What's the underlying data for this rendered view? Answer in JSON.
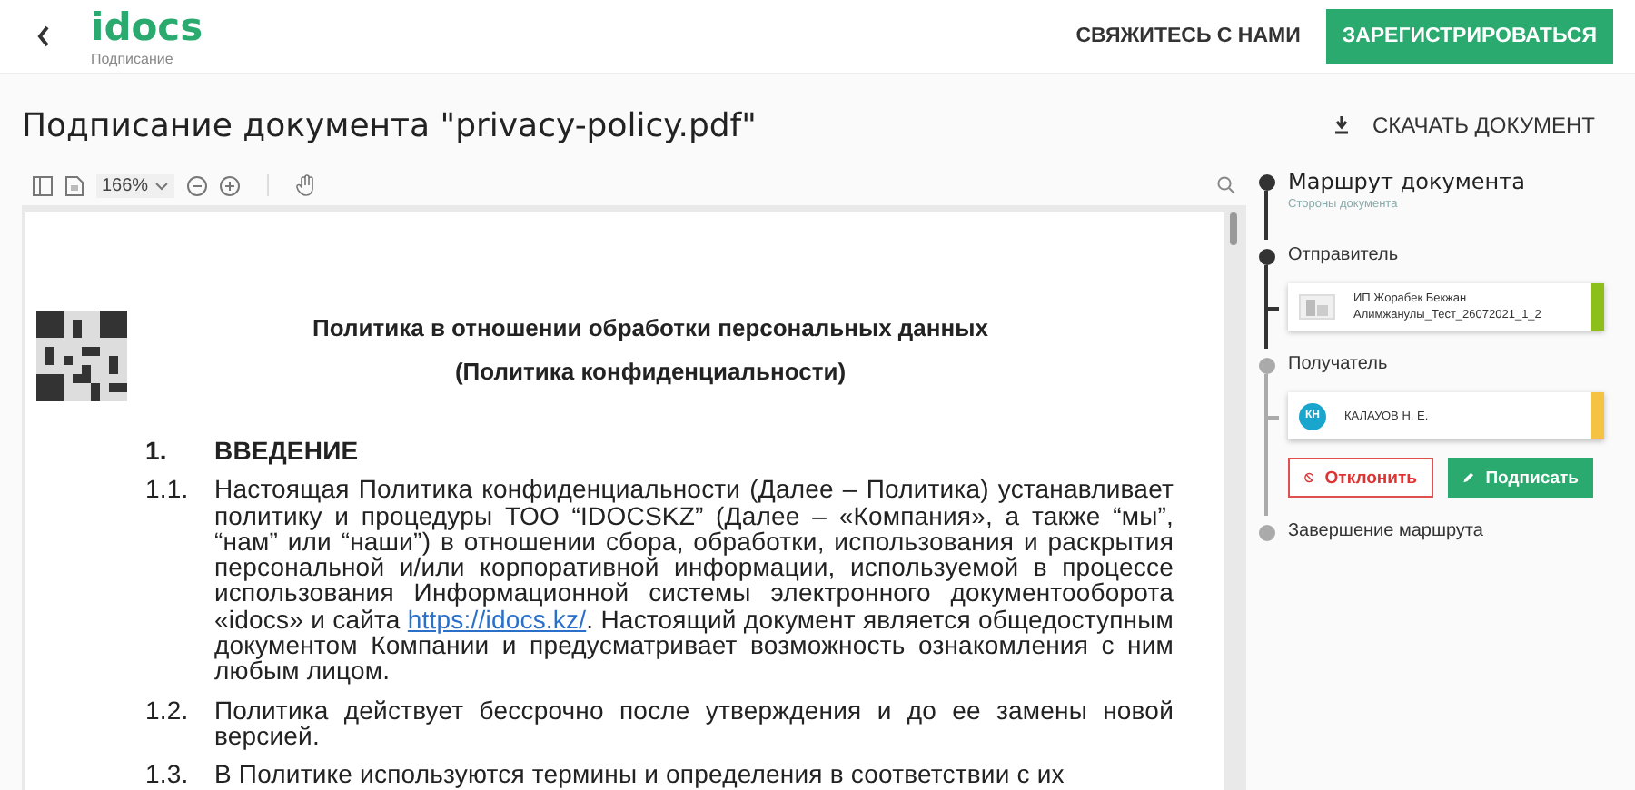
{
  "header": {
    "logo": "idocs",
    "logo_caption": "Подписание",
    "contact": "СВЯЖИТЕСЬ С НАМИ",
    "register": "ЗАРЕГИСТРИРОВАТЬСЯ"
  },
  "page": {
    "title": "Подписание документа \"privacy-policy.pdf\"",
    "download": "СКАЧАТЬ ДОКУМЕНТ"
  },
  "viewer": {
    "zoom": "166%",
    "document": {
      "heading": "Политика в отношении обработки персональных данных",
      "subheading": "(Политика конфиденциальности)",
      "sections": [
        {
          "kind": "heading",
          "number": "1.",
          "text": "ВВЕДЕНИЕ"
        },
        {
          "kind": "paragraph",
          "number": "1.1.",
          "text": "Настоящая Политика конфиденциальности (Далее – Политика) устанавливает политику и процедуры ТОО “IDOCSKZ” (Далее – «Компания», а также “мы”, “нам” или “наши”) в отношении сбора, обработки, использования и раскрытия персональной и/или корпоративной информации, используемой в процессе использования Информационной системы электронного документооборота «idocs» и сайта",
          "link": "https://idocs.kz/",
          "text_after": ". Настоящий документ является общедоступным документом Компании и предусматривает возможность ознакомления с ним любым лицом."
        },
        {
          "kind": "paragraph",
          "number": "1.2.",
          "text": "Политика действует бессрочно после утверждения и до ее замены новой версией."
        },
        {
          "kind": "paragraph",
          "number": "1.3.",
          "text": "В Политике используются термины и определения в соответствии с их"
        }
      ]
    }
  },
  "route": {
    "title": "Маршрут документа",
    "subtitle": "Стороны документа",
    "steps": [
      {
        "kind": "step",
        "label": "Отправитель",
        "done": true
      },
      {
        "kind": "card",
        "lines": [
          "ИП Жорабек Бекжан",
          "Алимжанулы_Тест_26072021_1_2"
        ],
        "color": "#8cbf1a",
        "done": true
      },
      {
        "kind": "step",
        "label": "Получатель",
        "done": false
      },
      {
        "kind": "card",
        "initials": "КН",
        "lines": [
          "КАЛАУОВ Н. Е."
        ],
        "color": "#f5c242",
        "done": false
      },
      {
        "kind": "actions",
        "reject": "Отклонить",
        "sign": "Подписать"
      },
      {
        "kind": "step",
        "label": "Завершение маршрута",
        "done": false
      }
    ]
  }
}
